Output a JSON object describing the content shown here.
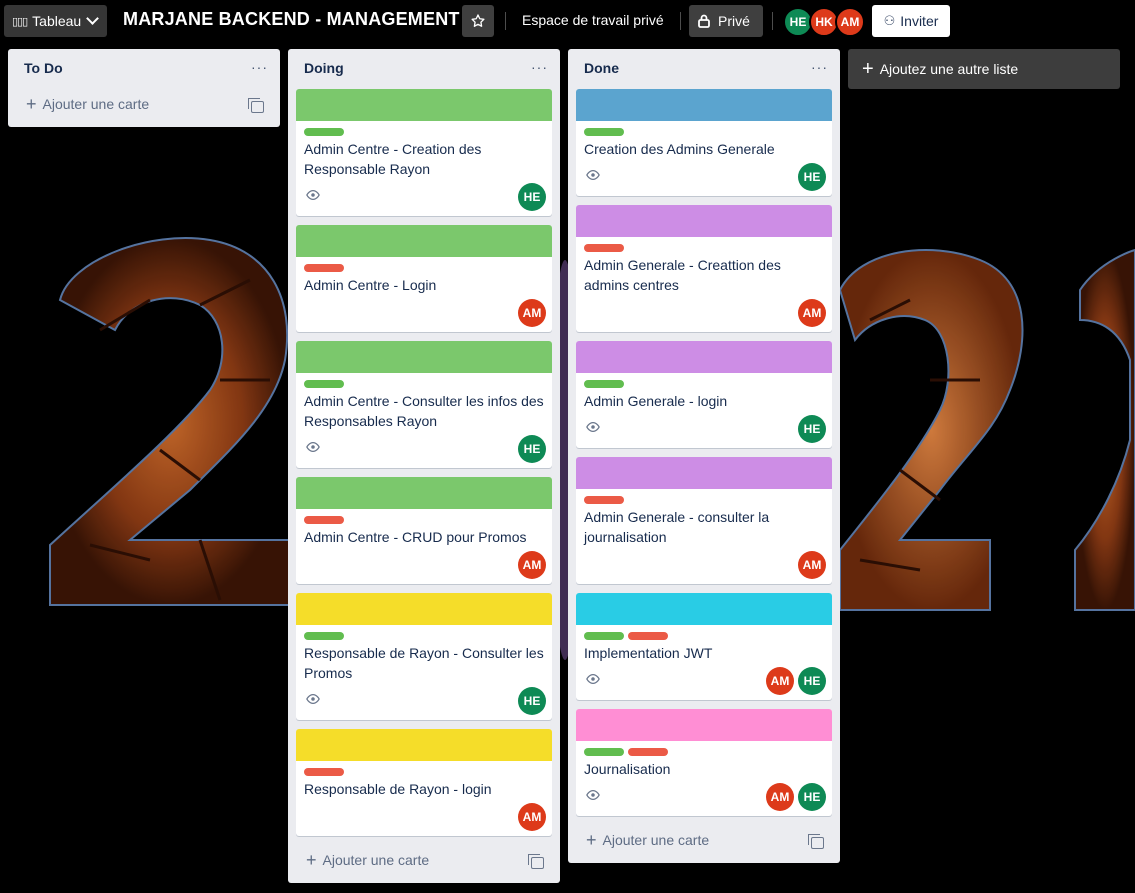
{
  "colors": {
    "green": "#61bd4f",
    "red": "#eb5a46",
    "cover_green": "#7bc86c",
    "cover_yellow": "#f5dd29",
    "cover_blue": "#5ba4cf",
    "cover_purple": "#cd8de5",
    "cover_cyan": "#29cce5",
    "cover_pink": "#ff8ed4"
  },
  "header": {
    "view_label": "Tableau",
    "board_title": "MARJANE BACKEND - MANAGEMENT",
    "workspace_label": "Espace de travail privé",
    "privacy_label": "Privé",
    "members": [
      "HE",
      "HK",
      "AM"
    ],
    "invite_label": "Inviter"
  },
  "add_card_label": "Ajouter une carte",
  "add_list_label": "Ajoutez une autre liste",
  "lists": [
    {
      "title": "To Do",
      "cards": []
    },
    {
      "title": "Doing",
      "cards": [
        {
          "title": "Admin Centre - Creation des Responsable Rayon",
          "members": [
            "HE"
          ]
        },
        {
          "title": "Admin Centre - Login",
          "members": [
            "AM"
          ]
        },
        {
          "title": "Admin Centre - Consulter les infos des Responsables Rayon",
          "members": [
            "HE"
          ]
        },
        {
          "title": "Admin Centre - CRUD pour Promos",
          "members": [
            "AM"
          ]
        },
        {
          "title": "Responsable de Rayon - Consulter les Promos",
          "members": [
            "HE"
          ]
        },
        {
          "title": "Responsable de Rayon - login",
          "members": [
            "AM"
          ]
        }
      ]
    },
    {
      "title": "Done",
      "cards": [
        {
          "title": "Creation des Admins Generale",
          "members": [
            "HE"
          ]
        },
        {
          "title": "Admin Generale - Creattion des admins centres",
          "members": [
            "AM"
          ]
        },
        {
          "title": "Admin Generale - login",
          "members": [
            "HE"
          ]
        },
        {
          "title": "Admin Generale - consulter la journalisation",
          "members": [
            "AM"
          ]
        },
        {
          "title": "Implementation JWT",
          "members": [
            "AM",
            "HE"
          ]
        },
        {
          "title": "Journalisation",
          "members": [
            "AM",
            "HE"
          ]
        }
      ]
    }
  ]
}
